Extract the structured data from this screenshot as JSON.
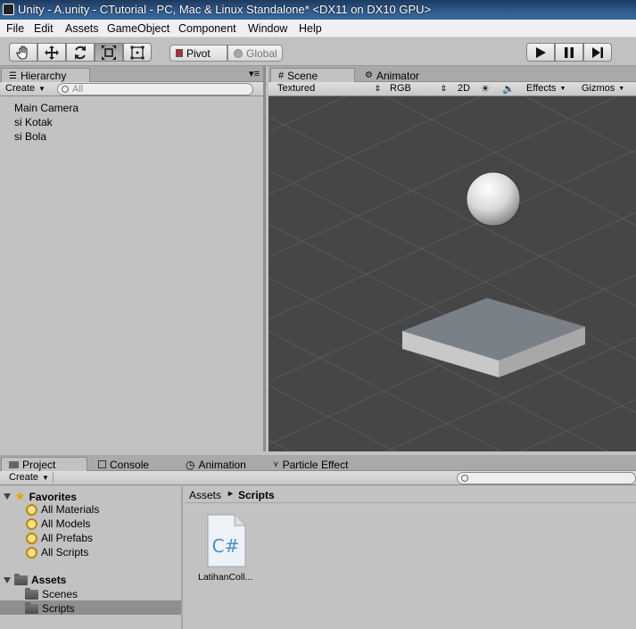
{
  "window": {
    "title": "Unity - A.unity - CTutorial - PC, Mac & Linux Standalone* <DX11 on DX10 GPU>"
  },
  "menu": [
    "File",
    "Edit",
    "Assets",
    "GameObject",
    "Component",
    "Window",
    "Help"
  ],
  "toolbar": {
    "tools": [
      "hand-tool",
      "move-tool",
      "rotate-tool",
      "scale-tool",
      "rect-tool"
    ],
    "active_tool": "scale-tool",
    "pivot_label": "Pivot",
    "global_label": "Global",
    "play": [
      "play",
      "pause",
      "step"
    ]
  },
  "hierarchy": {
    "tab_label": "Hierarchy",
    "create_label": "Create",
    "search_placeholder": "All",
    "items": [
      "Main Camera",
      "si Kotak",
      "si Bola"
    ]
  },
  "scene": {
    "tabs": [
      {
        "label": "Scene",
        "active": true
      },
      {
        "label": "Animator",
        "active": false
      }
    ],
    "shading": "Textured",
    "render_mode": "RGB",
    "mode_2d": "2D",
    "effects": "Effects",
    "gizmos": "Gizmos"
  },
  "bottom_tabs": [
    {
      "label": "Project",
      "active": true
    },
    {
      "label": "Console",
      "active": false
    },
    {
      "label": "Animation",
      "active": false
    },
    {
      "label": "Particle Effect",
      "active": false
    }
  ],
  "project": {
    "create_label": "Create",
    "favorites": {
      "label": "Favorites",
      "items": [
        "All Materials",
        "All Models",
        "All Prefabs",
        "All Scripts"
      ]
    },
    "assets": {
      "label": "Assets",
      "items": [
        "Scenes",
        "Scripts"
      ],
      "selected": "Scripts"
    },
    "breadcrumb": [
      "Assets",
      "Scripts"
    ],
    "files": [
      {
        "name": "LatihanColl...",
        "type": "C#"
      }
    ]
  },
  "colors": {
    "panel_bg": "#c2c2c2",
    "scene_bg": "#464646",
    "title_bar": "#2d5686",
    "selected_row": "#8f8f8f"
  }
}
